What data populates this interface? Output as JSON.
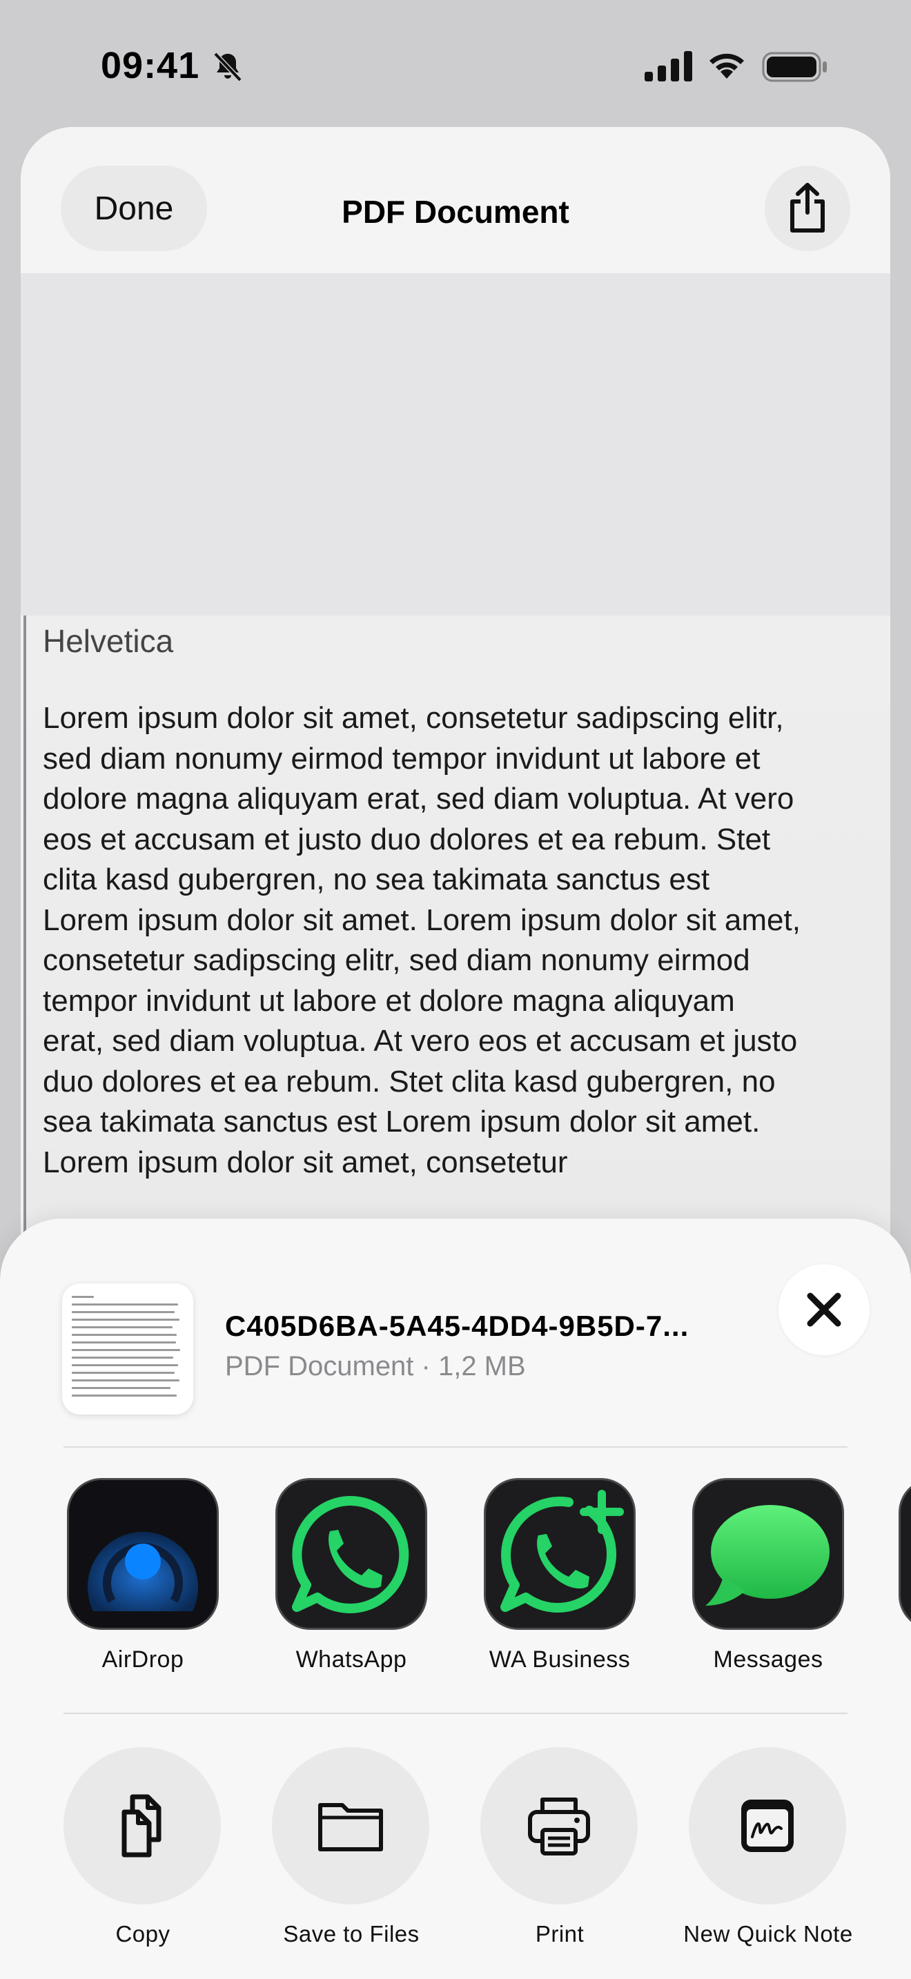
{
  "status_bar": {
    "time": "09:41"
  },
  "document_view": {
    "done_label": "Done",
    "title": "PDF Document",
    "page_font_label": "Helvetica",
    "page_text": "Lorem ipsum dolor sit amet, consetetur sadipscing elitr, sed diam nonumy eirmod tempor invidunt ut labore et dolore magna aliquyam erat, sed diam voluptua. At vero eos et accusam et justo duo dolores et ea rebum. Stet clita kasd gubergren, no sea takimata sanctus est Lorem ipsum dolor sit amet. Lorem ipsum dolor sit amet, consetetur sadipscing elitr, sed diam nonumy eirmod tempor invidunt ut labore et dolore magna aliquyam erat, sed diam voluptua. At vero eos et accusam et justo duo dolores et ea rebum. Stet clita kasd gubergren, no sea takimata sanctus est Lorem ipsum dolor sit amet. Lorem ipsum dolor sit amet, consetetur"
  },
  "share_sheet": {
    "file_name": "C405D6BA-5A45-4DD4-9B5D-7...",
    "file_meta": "PDF Document · 1,2 MB",
    "apps": [
      {
        "label": "AirDrop",
        "icon": "airdrop-icon"
      },
      {
        "label": "WhatsApp",
        "icon": "whatsapp-icon"
      },
      {
        "label": "WA Business",
        "icon": "whatsapp-business-icon"
      },
      {
        "label": "Messages",
        "icon": "messages-icon"
      }
    ],
    "actions": [
      {
        "label": "Copy",
        "icon": "copy-icon"
      },
      {
        "label": "Save to Files",
        "icon": "folder-icon"
      },
      {
        "label": "Print",
        "icon": "printer-icon"
      },
      {
        "label": "New Quick Note",
        "icon": "quick-note-icon"
      }
    ]
  },
  "colors": {
    "whatsapp_green": "#25d366",
    "messages_green": "#34c759",
    "airdrop_blue": "#0a84ff"
  }
}
